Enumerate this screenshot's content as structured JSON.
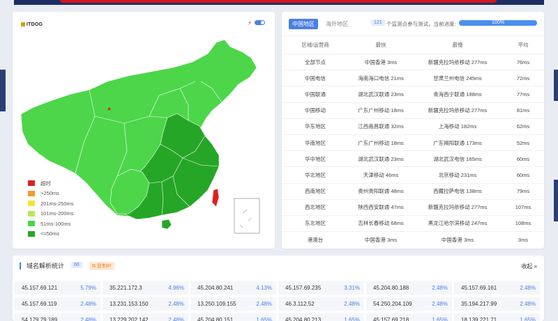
{
  "colors": {
    "timeout": "#e0201f",
    "gt250": "#f39a33",
    "r201_250": "#f5e33a",
    "r101_200": "#b7e85a",
    "r51_100": "#4dd64a",
    "le50": "#26a626",
    "accent": "#4a7fe4"
  },
  "map": {
    "logo_text": "ITDOG",
    "legend": [
      {
        "label": "超时",
        "color": "#e0201f"
      },
      {
        "label": ">250ms",
        "color": "#f39a33"
      },
      {
        "label": "201ms-250ms",
        "color": "#f5e33a"
      },
      {
        "label": "101ms-200ms",
        "color": "#b7e85a"
      },
      {
        "label": "51ms-100ms",
        "color": "#4dd64a"
      },
      {
        "label": "<=50ms",
        "color": "#26a626"
      }
    ]
  },
  "stats": {
    "tab_domestic": "中国地区",
    "tab_overseas": "海外地区",
    "node_count": "121",
    "progress_text": "个监测点参与测试，当前进度:",
    "progress_value": "100%",
    "columns": [
      "区域/运营商",
      "最快",
      "最慢",
      "平均"
    ],
    "rows": [
      [
        "全部节点",
        "中国香港 3ms",
        "新疆克拉玛依移动 277ms",
        "76ms"
      ],
      [
        "中国电信",
        "海南海口电信 21ms",
        "甘肃兰州电信 245ms",
        "72ms"
      ],
      [
        "中国联通",
        "湖北武汉联通 23ms",
        "青海西宁联通 188ms",
        "77ms"
      ],
      [
        "中国移动",
        "广东广州移动 18ms",
        "新疆克拉玛依移动 277ms",
        "81ms"
      ],
      [
        "华东地区",
        "江西南昌联通 32ms",
        "上海移动 182ms",
        "62ms"
      ],
      [
        "华南地区",
        "广东广州移动 18ms",
        "广东揭阳联通 173ms",
        "52ms"
      ],
      [
        "华中地区",
        "湖北武汉联通 23ms",
        "湖北武汉电信 165ms",
        "60ms"
      ],
      [
        "华北地区",
        "天津移动 46ms",
        "北京移动 231ms",
        "60ms"
      ],
      [
        "西南地区",
        "贵州贵阳联通 48ms",
        "西藏拉萨电信 138ms",
        "79ms"
      ],
      [
        "西北地区",
        "陕西西安联通 47ms",
        "新疆克拉玛依移动 277ms",
        "107ms"
      ],
      [
        "东北地区",
        "吉林长春移动 68ms",
        "黑龙江哈尔滨移动 247ms",
        "108ms"
      ],
      [
        "港澳台",
        "中国香港 3ms",
        "中国香港 3ms",
        "3ms"
      ]
    ]
  },
  "dns": {
    "title": "域名解析统计",
    "count": "66",
    "copy_label": "复制IP",
    "collapse_label": "收起",
    "ips": [
      {
        "ip": "45.157.69.121",
        "pct": "5.79%"
      },
      {
        "ip": "35.221.172.3",
        "pct": "4.96%"
      },
      {
        "ip": "45.204.80.241",
        "pct": "4.13%"
      },
      {
        "ip": "45.157.69.235",
        "pct": "3.31%"
      },
      {
        "ip": "45.204.80.188",
        "pct": "2.48%"
      },
      {
        "ip": "45.157.69.161",
        "pct": "2.48%"
      },
      {
        "ip": "45.157.69.119",
        "pct": "2.48%"
      },
      {
        "ip": "13.231.153.150",
        "pct": "2.48%"
      },
      {
        "ip": "13.250.109.155",
        "pct": "2.48%"
      },
      {
        "ip": "46.3.112.52",
        "pct": "2.48%"
      },
      {
        "ip": "54.250.204.109",
        "pct": "2.48%"
      },
      {
        "ip": "35.194.217.99",
        "pct": "2.48%"
      },
      {
        "ip": "54.179.79.189",
        "pct": "2.48%"
      },
      {
        "ip": "13.229.202.142",
        "pct": "2.48%"
      },
      {
        "ip": "45.204.80.151",
        "pct": "1.65%"
      },
      {
        "ip": "45.204.80.213",
        "pct": "1.65%"
      },
      {
        "ip": "45.157.69.218",
        "pct": "1.65%"
      },
      {
        "ip": "18.139.221.71",
        "pct": "1.65%"
      }
    ]
  }
}
